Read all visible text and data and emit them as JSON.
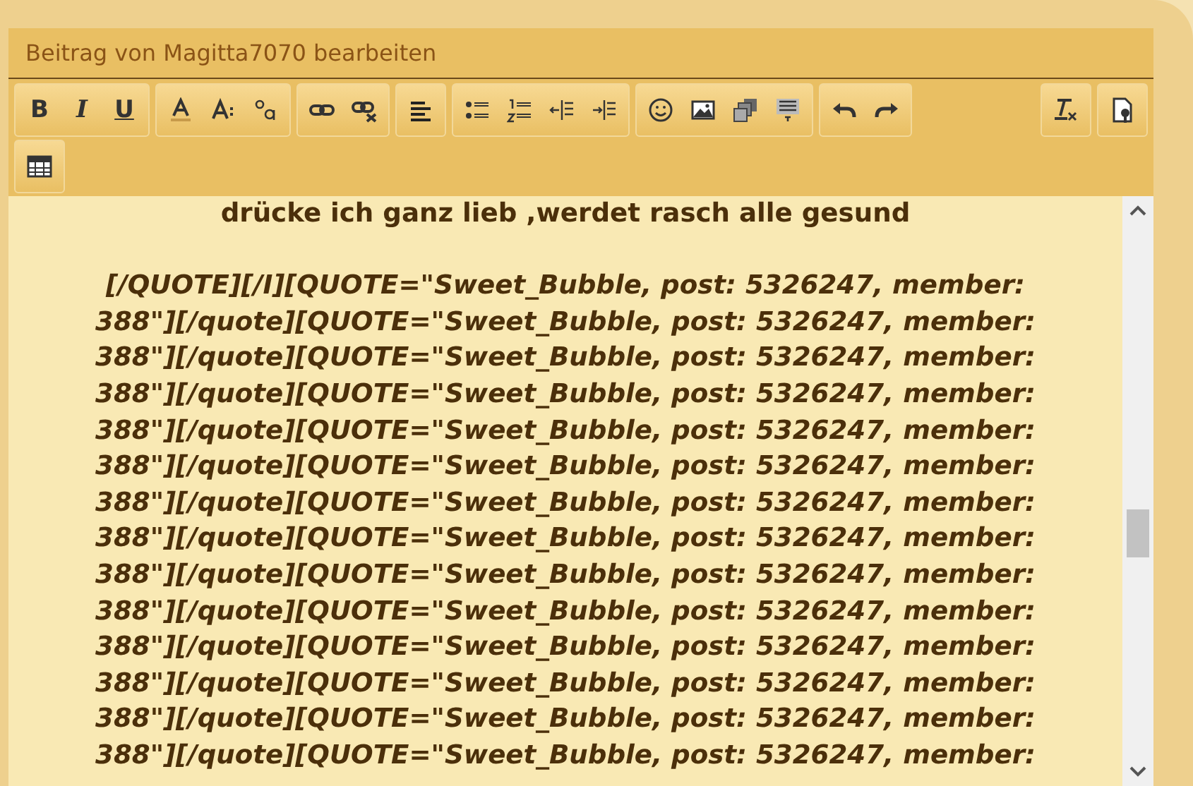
{
  "dialog": {
    "title": "Beitrag von Magitta7070 bearbeiten"
  },
  "toolbar": {
    "rows": [
      [
        {
          "buttons": [
            {
              "kind": "bold",
              "label": "B"
            },
            {
              "kind": "italic",
              "label": "I"
            },
            {
              "kind": "underline",
              "label": "U"
            }
          ]
        },
        {
          "buttons": [
            {
              "kind": "font-color"
            },
            {
              "kind": "font-size"
            },
            {
              "kind": "font-family"
            }
          ]
        },
        {
          "buttons": [
            {
              "kind": "link"
            },
            {
              "kind": "unlink"
            }
          ]
        },
        {
          "buttons": [
            {
              "kind": "align"
            }
          ]
        },
        {
          "buttons": [
            {
              "kind": "bullets"
            },
            {
              "kind": "numbers"
            },
            {
              "kind": "outdent"
            },
            {
              "kind": "indent"
            }
          ]
        },
        {
          "buttons": [
            {
              "kind": "smiley"
            },
            {
              "kind": "image"
            },
            {
              "kind": "media"
            },
            {
              "kind": "insert"
            }
          ]
        },
        {
          "buttons": [
            {
              "kind": "undo"
            },
            {
              "kind": "redo"
            }
          ]
        },
        {
          "buttons": [
            {
              "kind": "clear-format"
            }
          ]
        },
        {
          "buttons": [
            {
              "kind": "source"
            }
          ]
        }
      ],
      [
        {
          "buttons": [
            {
              "kind": "table"
            }
          ]
        }
      ]
    ]
  },
  "editor": {
    "paragraphs": [
      {
        "kind": "plain",
        "lines": [
          "drücke ich ganz lieb ,werdet rasch alle gesund"
        ]
      },
      {
        "kind": "italic",
        "lines": [
          "[/QUOTE][/I][QUOTE=\"Sweet_Bubble, post: 5326247, member:",
          "388\"][/quote][QUOTE=\"Sweet_Bubble, post: 5326247, member:",
          "388\"][/quote][QUOTE=\"Sweet_Bubble, post: 5326247, member:",
          "388\"][/quote][QUOTE=\"Sweet_Bubble, post: 5326247, member:",
          "388\"][/quote][QUOTE=\"Sweet_Bubble, post: 5326247, member:",
          "388\"][/quote][QUOTE=\"Sweet_Bubble, post: 5326247, member:",
          "388\"][/quote][QUOTE=\"Sweet_Bubble, post: 5326247, member:",
          "388\"][/quote][QUOTE=\"Sweet_Bubble, post: 5326247, member:",
          "388\"][/quote][QUOTE=\"Sweet_Bubble, post: 5326247, member:",
          "388\"][/quote][QUOTE=\"Sweet_Bubble, post: 5326247, member:",
          "388\"][/quote][QUOTE=\"Sweet_Bubble, post: 5326247, member:",
          "388\"][/quote][QUOTE=\"Sweet_Bubble, post: 5326247, member:",
          "388\"][/quote][QUOTE=\"Sweet_Bubble, post: 5326247, member:",
          "388\"][/quote][QUOTE=\"Sweet_Bubble, post: 5326247, member:"
        ]
      }
    ]
  }
}
